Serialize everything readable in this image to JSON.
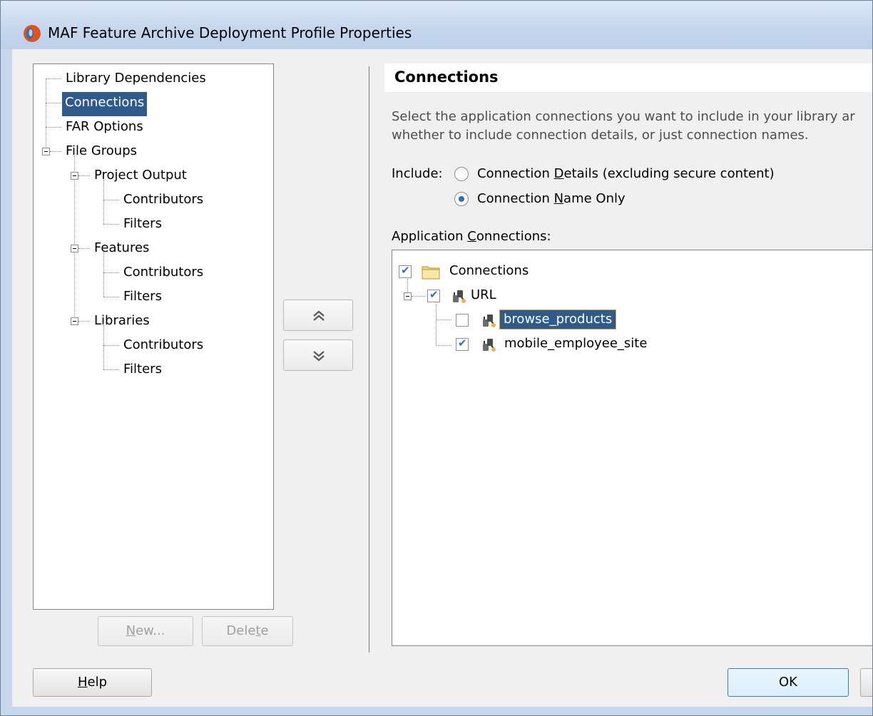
{
  "window": {
    "title": "MAF Feature Archive Deployment Profile Properties"
  },
  "nav_tree": {
    "items": [
      {
        "label": "Library Dependencies"
      },
      {
        "label": "Connections"
      },
      {
        "label": "FAR Options"
      },
      {
        "label": "File Groups"
      },
      {
        "label": "Project Output"
      },
      {
        "label": "Contributors"
      },
      {
        "label": "Filters"
      },
      {
        "label": "Features"
      },
      {
        "label": "Contributors"
      },
      {
        "label": "Filters"
      },
      {
        "label": "Libraries"
      },
      {
        "label": "Contributors"
      },
      {
        "label": "Filters"
      }
    ],
    "selected": "Connections"
  },
  "nav_buttons": {
    "new_label_pre": "",
    "new_label_mnemonic": "N",
    "new_label_post": "ew...",
    "delete_label_pre": "Dele",
    "delete_label_mnemonic": "t",
    "delete_label_post": "e"
  },
  "panel": {
    "title": "Connections",
    "description_line1": "Select the application connections you want to include in your library ar",
    "description_line2": "whether to include connection details, or just connection names.",
    "include_label": "Include:",
    "radio_options": [
      {
        "pre": "Connection ",
        "mnemonic": "D",
        "post": "etails (excluding secure content)",
        "checked": false
      },
      {
        "pre": "Connection ",
        "mnemonic": "N",
        "post": "ame Only",
        "checked": true
      }
    ],
    "app_connections_label_pre": "Application ",
    "app_connections_label_mnemonic": "C",
    "app_connections_label_post": "onnections:"
  },
  "connections_tree": {
    "root": {
      "label": "Connections",
      "checked": true
    },
    "group": {
      "label": "URL",
      "checked": true
    },
    "items": [
      {
        "label": "browse_products",
        "checked": false,
        "selected": true
      },
      {
        "label": "mobile_employee_site",
        "checked": true,
        "selected": false
      }
    ]
  },
  "footer": {
    "help_mnemonic": "H",
    "help_post": "elp",
    "ok_label": "OK"
  },
  "colors": {
    "selection": "#2f5b8c",
    "titlebar": "#c6d8ee",
    "check_accent": "#2c6ecb"
  },
  "icons": {
    "title": "oracle-logo-icon",
    "folder": "folder-icon",
    "connection": "connection-plug-icon",
    "move_up": "double-chevron-up-icon",
    "move_down": "double-chevron-down-icon"
  }
}
